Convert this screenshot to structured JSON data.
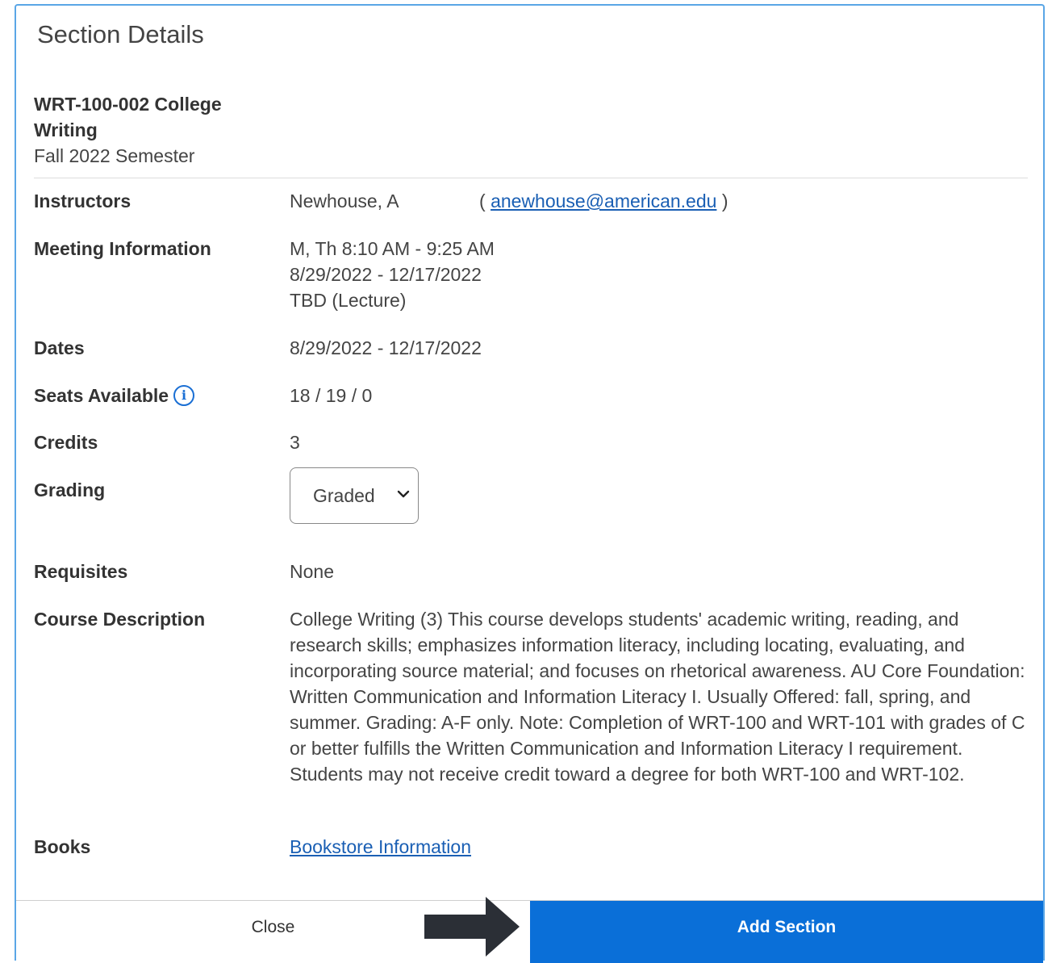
{
  "dialog": {
    "title": "Section Details"
  },
  "course": {
    "name": "WRT-100-002 College Writing",
    "term": "Fall 2022 Semester"
  },
  "details": {
    "instructors": {
      "label": "Instructors",
      "name": "Newhouse, A",
      "open_paren": "(",
      "email": "anewhouse@american.edu",
      "close_paren": ")"
    },
    "meeting": {
      "label": "Meeting Information",
      "line1": "M, Th 8:10 AM - 9:25 AM",
      "line2": "8/29/2022 - 12/17/2022",
      "line3": "TBD (Lecture)"
    },
    "dates": {
      "label": "Dates",
      "value": "8/29/2022 - 12/17/2022"
    },
    "seats": {
      "label": "Seats Available",
      "icon": "info-icon",
      "value": "18 / 19 / 0"
    },
    "credits": {
      "label": "Credits",
      "value": "3"
    },
    "grading": {
      "label": "Grading",
      "selected": "Graded"
    },
    "requisites": {
      "label": "Requisites",
      "value": "None"
    },
    "description": {
      "label": "Course Description",
      "value": "College Writing (3) This course develops students' academic writing, reading, and research skills; emphasizes information literacy, including locating, evaluating, and incorporating source material; and focuses on rhetorical awareness. AU Core Foundation: Written Communication and Information Literacy I. Usually Offered: fall, spring, and summer. Grading: A-F only. Note: Completion of WRT-100 and WRT-101 with grades of C or better fulfills the Written Communication and Information Literacy I requirement. Students may not receive credit toward a degree for both WRT-100 and WRT-102."
    },
    "books": {
      "label": "Books",
      "link": "Bookstore Information"
    }
  },
  "footer": {
    "close_label": "Close",
    "add_label": "Add Section"
  },
  "colors": {
    "primary_button": "#0a6fd8",
    "link": "#1a5fb4",
    "border": "#5aa6e6"
  }
}
